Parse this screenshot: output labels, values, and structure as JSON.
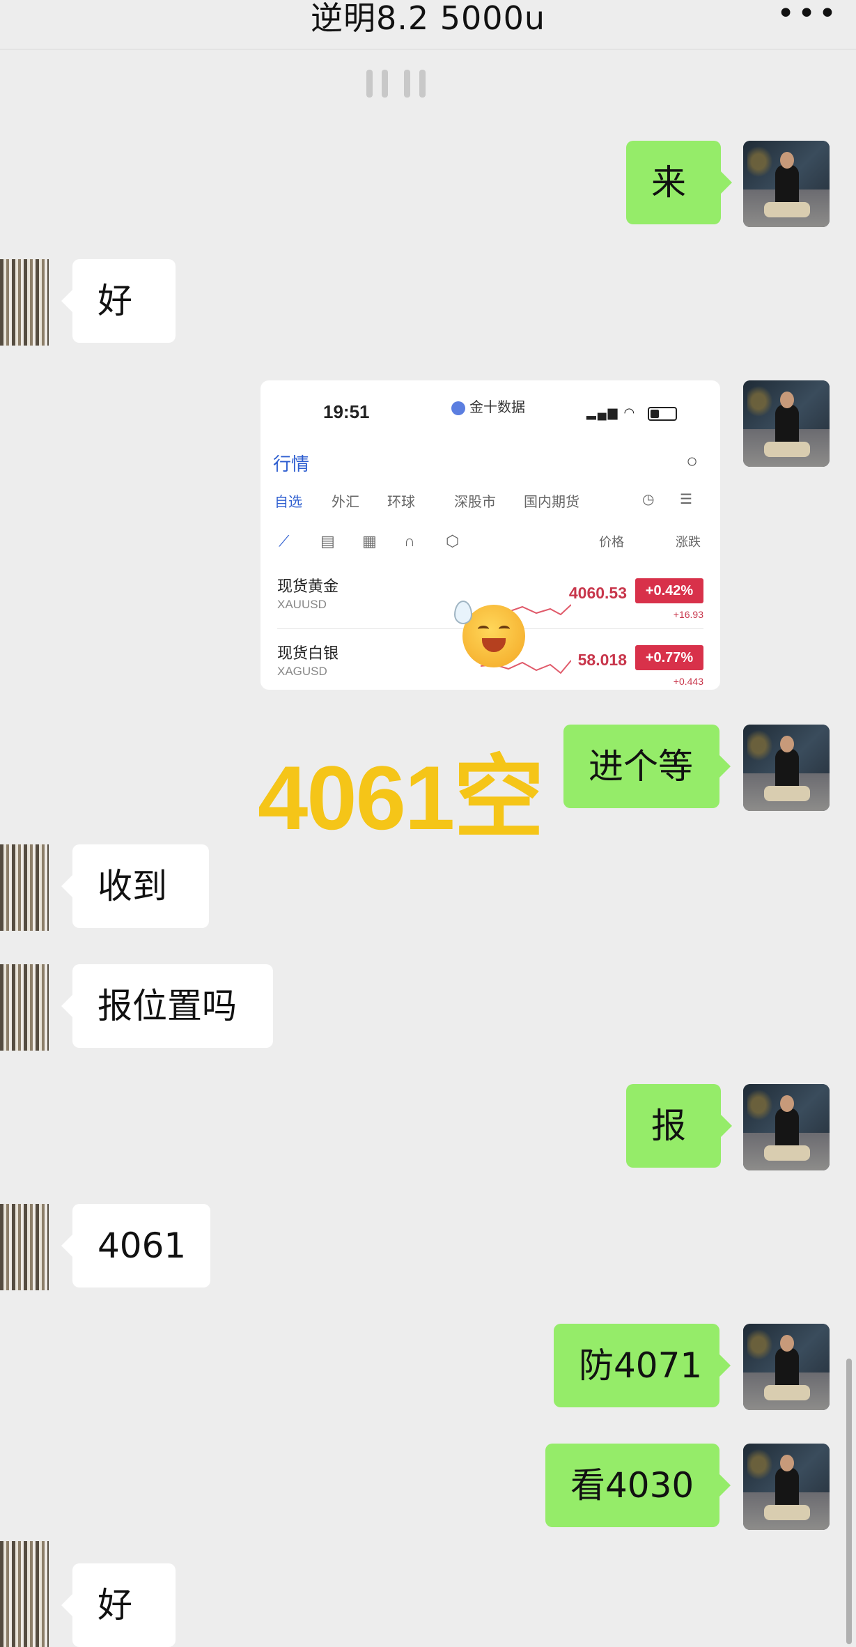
{
  "header": {
    "title": "逆明8.2 5000u",
    "more_icon": "more-horizontal-icon"
  },
  "messages": [
    {
      "side": "me",
      "text": "来"
    },
    {
      "side": "other",
      "text": "好"
    },
    {
      "side": "me",
      "type": "image"
    },
    {
      "side": "me",
      "text": "进个等"
    },
    {
      "side": "other",
      "text": "收到"
    },
    {
      "side": "other",
      "text": "报位置吗"
    },
    {
      "side": "me",
      "text": "报"
    },
    {
      "side": "other",
      "text": "4061"
    },
    {
      "side": "me",
      "text": "防4071"
    },
    {
      "side": "me",
      "text": "看4030"
    },
    {
      "side": "other",
      "text": "好"
    }
  ],
  "overlay": {
    "text": "4061空",
    "color": "#f5c518"
  },
  "screenshot": {
    "time": "19:51",
    "app_name": "金十数据",
    "section": "行情",
    "tabs": [
      "自选",
      "外汇",
      "环球",
      "深股市",
      "国内期货"
    ],
    "column_headers": [
      "价格",
      "涨跌"
    ],
    "rows": [
      {
        "name": "现货黄金",
        "code": "XAUUSD",
        "price": "4060.53",
        "change_pct": "+0.42%",
        "change": "+16.93"
      },
      {
        "name": "现货白银",
        "code": "XAGUSD",
        "price": "58.018",
        "change_pct": "+0.77%",
        "change": "+0.443"
      }
    ]
  },
  "colors": {
    "background": "#ededed",
    "my_bubble": "#95ec69",
    "other_bubble": "#ffffff",
    "price_red": "#d8314a"
  }
}
